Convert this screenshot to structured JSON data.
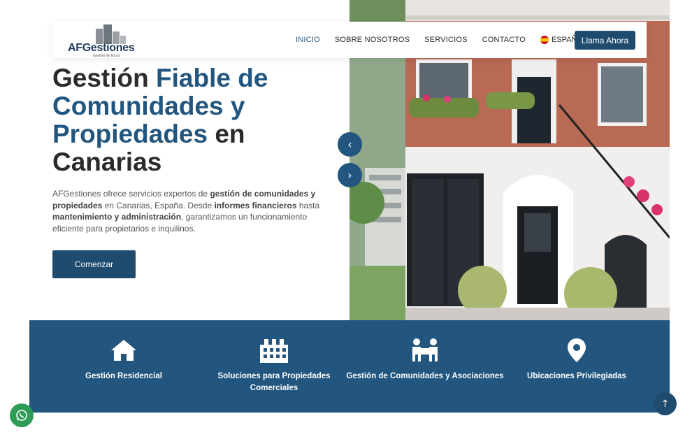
{
  "header": {
    "logo_text": "AFGestiones",
    "logo_sub": "Gestión de fincas",
    "nav": [
      "INICIO",
      "SOBRE NOSOTROS",
      "SERVICIOS",
      "CONTACTO"
    ],
    "language": "ESPAÑOL",
    "call_label": "Llama Ahora"
  },
  "hero": {
    "title_1": "Gestión ",
    "title_2": "Fiable de Comunidades y Propiedades",
    "title_3": " en Canarias",
    "desc_1": "AFGestiones ofrece servicios expertos de ",
    "desc_2": "gestión de comunidades y propiedades",
    "desc_3": " en Canarias, España. Desde ",
    "desc_4": "informes financieros",
    "desc_5": " hasta ",
    "desc_6": "mantenimiento y administración",
    "desc_7": ", garantizamos un funcionamiento eficiente para propietarios e inquilinos.",
    "cta_label": "Comenzar",
    "prev_arrow": "‹",
    "next_arrow": "›"
  },
  "features": [
    {
      "label": "Gestión Residencial",
      "icon": "house-icon"
    },
    {
      "label": "Soluciones para Propiedades Comerciales",
      "icon": "building-icon"
    },
    {
      "label": "Gestión de Comunidades y Asociaciones",
      "icon": "people-icon"
    },
    {
      "label": "Ubicaciones Privilegiadas",
      "icon": "map-pin-icon"
    }
  ],
  "floating": {
    "whatsapp_icon": "whatsapp-icon",
    "to_top_label": "↑"
  },
  "colors": {
    "primary": "#22567e",
    "button": "#1f4b6e",
    "whatsapp": "#2e9c55"
  }
}
